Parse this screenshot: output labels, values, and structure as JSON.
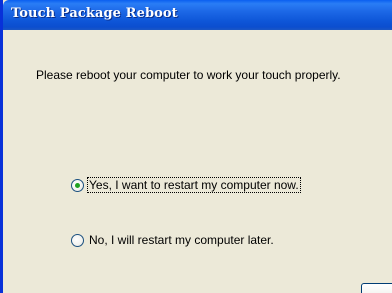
{
  "window": {
    "title": "Touch Package Reboot"
  },
  "dialog": {
    "message": "Please reboot your computer to work your touch properly."
  },
  "options": [
    {
      "label": "Yes, I want to restart my computer now.",
      "selected": true
    },
    {
      "label": "No, I will restart my computer later.",
      "selected": false
    }
  ],
  "colors": {
    "titlebar": "#0b4ecf",
    "dialog_background": "#ece9d8",
    "radio_selected_dot": "#21a121"
  }
}
